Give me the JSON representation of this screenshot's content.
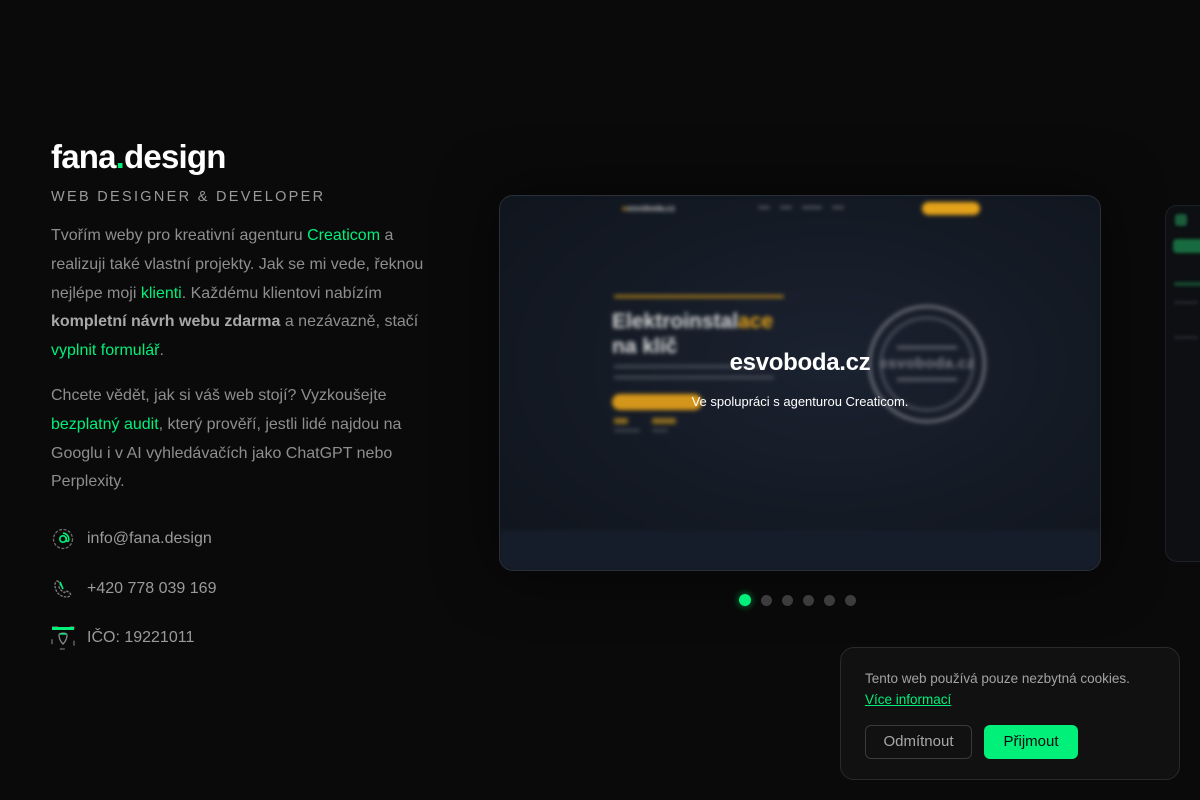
{
  "brand": {
    "logo_prefix": "fana",
    "logo_dot": ".",
    "logo_suffix": "design",
    "accent_color": "#00f07a"
  },
  "hero": {
    "subtitle": "WEB DESIGNER & DEVELOPER",
    "para1": {
      "t1": "Tvořím weby pro kreativní agenturu ",
      "link1": "Creaticom",
      "t2": " a realizuji také vlastní projekty. Jak se mi vede, řeknou nejlépe moji ",
      "link2": "klienti",
      "t3": ". Každému klientovi nabízím ",
      "bold": "kompletní návrh webu zdarma",
      "t4": " a nezávazně, stačí ",
      "link3": "vyplnit formulář",
      "t5": "."
    },
    "para2": {
      "t1": "Chcete vědět, jak si váš web stojí? Vyzkoušejte ",
      "link1": "bezplatný audit",
      "t2": ", který prověří, jestli lidé najdou na Googlu i v AI vyhledávačích jako ChatGPT nebo Perplexity."
    }
  },
  "contacts": [
    {
      "icon": "at-icon",
      "text": "info@fana.design"
    },
    {
      "icon": "phone-icon",
      "text": "+420 778 039 169"
    },
    {
      "icon": "id-card-icon",
      "text": "IČO: 19221011"
    }
  ],
  "carousel": {
    "active_index": 0,
    "dot_count": 6,
    "slide": {
      "title": "esvoboda.cz",
      "subtitle": "Ve spolupráci s agenturou Creaticom."
    }
  },
  "cookie": {
    "text": "Tento web používá pouze nezbytná cookies.",
    "link": "Více informací",
    "decline": "Odmítnout",
    "accept": "Přijmout"
  }
}
